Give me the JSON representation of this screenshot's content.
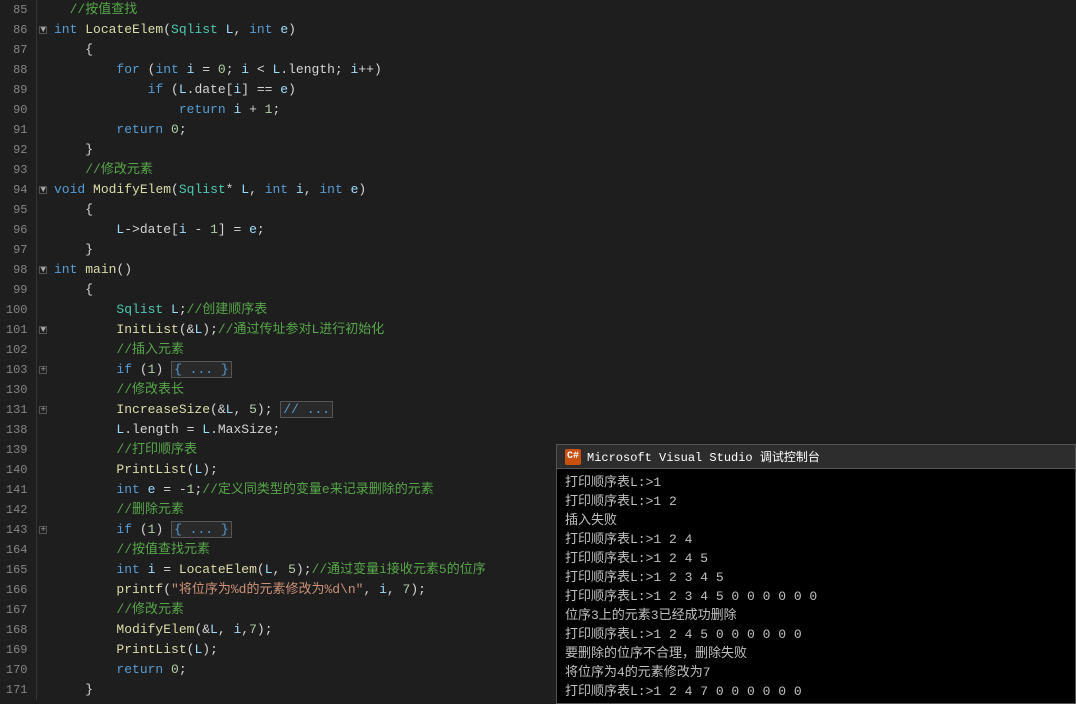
{
  "editor": {
    "lines": [
      {
        "num": 85,
        "fold": "",
        "content": [
          {
            "t": "cmt",
            "v": "  //按值查找"
          }
        ]
      },
      {
        "num": 86,
        "fold": "▼",
        "content": [
          {
            "t": "kw",
            "v": "int"
          },
          {
            "t": "white",
            "v": " "
          },
          {
            "t": "fn",
            "v": "LocateElem"
          },
          {
            "t": "white",
            "v": "("
          },
          {
            "t": "type",
            "v": "Sqlist"
          },
          {
            "t": "white",
            "v": " "
          },
          {
            "t": "param",
            "v": "L"
          },
          {
            "t": "white",
            "v": ", "
          },
          {
            "t": "kw",
            "v": "int"
          },
          {
            "t": "white",
            "v": " "
          },
          {
            "t": "param",
            "v": "e"
          },
          {
            "t": "white",
            "v": ")"
          }
        ]
      },
      {
        "num": 87,
        "fold": "",
        "content": [
          {
            "t": "white",
            "v": "    {"
          }
        ]
      },
      {
        "num": 88,
        "fold": "",
        "content": [
          {
            "t": "white",
            "v": "        "
          },
          {
            "t": "kw",
            "v": "for"
          },
          {
            "t": "white",
            "v": " ("
          },
          {
            "t": "kw",
            "v": "int"
          },
          {
            "t": "white",
            "v": " "
          },
          {
            "t": "param",
            "v": "i"
          },
          {
            "t": "white",
            "v": " = "
          },
          {
            "t": "num",
            "v": "0"
          },
          {
            "t": "white",
            "v": "; "
          },
          {
            "t": "param",
            "v": "i"
          },
          {
            "t": "white",
            "v": " < "
          },
          {
            "t": "param",
            "v": "L"
          },
          {
            "t": "white",
            "v": ".length; "
          },
          {
            "t": "param",
            "v": "i"
          },
          {
            "t": "white",
            "v": "++)"
          }
        ]
      },
      {
        "num": 89,
        "fold": "",
        "content": [
          {
            "t": "white",
            "v": "            "
          },
          {
            "t": "kw",
            "v": "if"
          },
          {
            "t": "white",
            "v": " ("
          },
          {
            "t": "param",
            "v": "L"
          },
          {
            "t": "white",
            "v": ".date["
          },
          {
            "t": "param",
            "v": "i"
          },
          {
            "t": "white",
            "v": "] == "
          },
          {
            "t": "param",
            "v": "e"
          },
          {
            "t": "white",
            "v": ")"
          }
        ]
      },
      {
        "num": 90,
        "fold": "",
        "content": [
          {
            "t": "white",
            "v": "                "
          },
          {
            "t": "kw",
            "v": "return"
          },
          {
            "t": "white",
            "v": " "
          },
          {
            "t": "param",
            "v": "i"
          },
          {
            "t": "white",
            "v": " + "
          },
          {
            "t": "num",
            "v": "1"
          },
          {
            "t": "white",
            "v": ";"
          }
        ]
      },
      {
        "num": 91,
        "fold": "",
        "content": [
          {
            "t": "white",
            "v": "        "
          },
          {
            "t": "kw",
            "v": "return"
          },
          {
            "t": "white",
            "v": " "
          },
          {
            "t": "num",
            "v": "0"
          },
          {
            "t": "white",
            "v": ";"
          }
        ]
      },
      {
        "num": 92,
        "fold": "",
        "content": [
          {
            "t": "white",
            "v": "    }"
          }
        ]
      },
      {
        "num": 93,
        "fold": "",
        "content": [
          {
            "t": "white",
            "v": "    "
          },
          {
            "t": "cmt",
            "v": "//修改元素"
          }
        ]
      },
      {
        "num": 94,
        "fold": "▼",
        "content": [
          {
            "t": "kw",
            "v": "void"
          },
          {
            "t": "white",
            "v": " "
          },
          {
            "t": "fn",
            "v": "ModifyElem"
          },
          {
            "t": "white",
            "v": "("
          },
          {
            "t": "type",
            "v": "Sqlist"
          },
          {
            "t": "white",
            "v": "* "
          },
          {
            "t": "param",
            "v": "L"
          },
          {
            "t": "white",
            "v": ", "
          },
          {
            "t": "kw",
            "v": "int"
          },
          {
            "t": "white",
            "v": " "
          },
          {
            "t": "param",
            "v": "i"
          },
          {
            "t": "white",
            "v": ", "
          },
          {
            "t": "kw",
            "v": "int"
          },
          {
            "t": "white",
            "v": " "
          },
          {
            "t": "param",
            "v": "e"
          },
          {
            "t": "white",
            "v": ")"
          }
        ]
      },
      {
        "num": 95,
        "fold": "",
        "content": [
          {
            "t": "white",
            "v": "    {"
          }
        ]
      },
      {
        "num": 96,
        "fold": "",
        "content": [
          {
            "t": "white",
            "v": "        "
          },
          {
            "t": "param",
            "v": "L"
          },
          {
            "t": "white",
            "v": "->date["
          },
          {
            "t": "param",
            "v": "i"
          },
          {
            "t": "white",
            "v": " - "
          },
          {
            "t": "num",
            "v": "1"
          },
          {
            "t": "white",
            "v": "] = "
          },
          {
            "t": "param",
            "v": "e"
          },
          {
            "t": "white",
            "v": ";"
          }
        ]
      },
      {
        "num": 97,
        "fold": "",
        "content": [
          {
            "t": "white",
            "v": "    }"
          }
        ]
      },
      {
        "num": 98,
        "fold": "▼",
        "content": [
          {
            "t": "kw",
            "v": "int"
          },
          {
            "t": "white",
            "v": " "
          },
          {
            "t": "fn",
            "v": "main"
          },
          {
            "t": "white",
            "v": "()"
          }
        ]
      },
      {
        "num": 99,
        "fold": "",
        "content": [
          {
            "t": "white",
            "v": "    {"
          }
        ]
      },
      {
        "num": 100,
        "fold": "",
        "content": [
          {
            "t": "white",
            "v": "        "
          },
          {
            "t": "type",
            "v": "Sqlist"
          },
          {
            "t": "white",
            "v": " "
          },
          {
            "t": "param",
            "v": "L"
          },
          {
            "t": "white",
            "v": ";"
          },
          {
            "t": "cmt",
            "v": "//创建顺序表"
          }
        ]
      },
      {
        "num": 101,
        "fold": "▼",
        "content": [
          {
            "t": "white",
            "v": "        "
          },
          {
            "t": "fn",
            "v": "InitList"
          },
          {
            "t": "white",
            "v": "(&"
          },
          {
            "t": "param",
            "v": "L"
          },
          {
            "t": "white",
            "v": ");"
          },
          {
            "t": "cmt",
            "v": "//通过传址参对L进行初始化"
          }
        ]
      },
      {
        "num": 102,
        "fold": "",
        "content": [
          {
            "t": "white",
            "v": "        "
          },
          {
            "t": "cmt",
            "v": "//插入元素"
          }
        ]
      },
      {
        "num": 103,
        "fold": "+",
        "content": [
          {
            "t": "white",
            "v": "        "
          },
          {
            "t": "kw",
            "v": "if"
          },
          {
            "t": "white",
            "v": " ("
          },
          {
            "t": "num",
            "v": "1"
          },
          {
            "t": "white",
            "v": ") "
          },
          {
            "t": "expand",
            "v": "{ ... }"
          }
        ]
      },
      {
        "num": 130,
        "fold": "",
        "content": [
          {
            "t": "white",
            "v": "        "
          },
          {
            "t": "cmt",
            "v": "//修改表长"
          }
        ]
      },
      {
        "num": 131,
        "fold": "+",
        "content": [
          {
            "t": "white",
            "v": "        "
          },
          {
            "t": "fn",
            "v": "IncreaseSize"
          },
          {
            "t": "white",
            "v": "(&"
          },
          {
            "t": "param",
            "v": "L"
          },
          {
            "t": "white",
            "v": ", "
          },
          {
            "t": "num",
            "v": "5"
          },
          {
            "t": "white",
            "v": "); "
          },
          {
            "t": "expand",
            "v": "// ..."
          }
        ]
      },
      {
        "num": 138,
        "fold": "",
        "content": [
          {
            "t": "white",
            "v": "        "
          },
          {
            "t": "param",
            "v": "L"
          },
          {
            "t": "white",
            "v": ".length = "
          },
          {
            "t": "param",
            "v": "L"
          },
          {
            "t": "white",
            "v": ".MaxSize;"
          }
        ]
      },
      {
        "num": 139,
        "fold": "",
        "content": [
          {
            "t": "white",
            "v": "        "
          },
          {
            "t": "cmt",
            "v": "//打印顺序表"
          }
        ]
      },
      {
        "num": 140,
        "fold": "",
        "content": [
          {
            "t": "white",
            "v": "        "
          },
          {
            "t": "fn",
            "v": "PrintList"
          },
          {
            "t": "white",
            "v": "("
          },
          {
            "t": "param",
            "v": "L"
          },
          {
            "t": "white",
            "v": ");"
          }
        ]
      },
      {
        "num": 141,
        "fold": "",
        "content": [
          {
            "t": "white",
            "v": "        "
          },
          {
            "t": "kw",
            "v": "int"
          },
          {
            "t": "white",
            "v": " "
          },
          {
            "t": "param",
            "v": "e"
          },
          {
            "t": "white",
            "v": " = -"
          },
          {
            "t": "num",
            "v": "1"
          },
          {
            "t": "white",
            "v": ";"
          },
          {
            "t": "cmt",
            "v": "//定义同类型的变量e来记录删除的元素"
          }
        ]
      },
      {
        "num": 142,
        "fold": "",
        "content": [
          {
            "t": "white",
            "v": "        "
          },
          {
            "t": "cmt",
            "v": "//删除元素"
          }
        ]
      },
      {
        "num": 143,
        "fold": "+",
        "content": [
          {
            "t": "white",
            "v": "        "
          },
          {
            "t": "kw",
            "v": "if"
          },
          {
            "t": "white",
            "v": " ("
          },
          {
            "t": "num",
            "v": "1"
          },
          {
            "t": "white",
            "v": ") "
          },
          {
            "t": "expand",
            "v": "{ ... }"
          }
        ]
      },
      {
        "num": 164,
        "fold": "",
        "content": [
          {
            "t": "white",
            "v": "        "
          },
          {
            "t": "cmt",
            "v": "//按值查找元素"
          }
        ]
      },
      {
        "num": 165,
        "fold": "",
        "content": [
          {
            "t": "white",
            "v": "        "
          },
          {
            "t": "kw",
            "v": "int"
          },
          {
            "t": "white",
            "v": " "
          },
          {
            "t": "param",
            "v": "i"
          },
          {
            "t": "white",
            "v": " = "
          },
          {
            "t": "fn",
            "v": "LocateElem"
          },
          {
            "t": "white",
            "v": "("
          },
          {
            "t": "param",
            "v": "L"
          },
          {
            "t": "white",
            "v": ", "
          },
          {
            "t": "num",
            "v": "5"
          },
          {
            "t": "white",
            "v": ");"
          },
          {
            "t": "cmt",
            "v": "//通过变量i接收元素5的位序"
          }
        ]
      },
      {
        "num": 166,
        "fold": "",
        "content": [
          {
            "t": "white",
            "v": "        "
          },
          {
            "t": "fn",
            "v": "printf"
          },
          {
            "t": "white",
            "v": "("
          },
          {
            "t": "str",
            "v": "\"将位序为%d的元素修改为%d\\n\""
          },
          {
            "t": "white",
            "v": ", "
          },
          {
            "t": "param",
            "v": "i"
          },
          {
            "t": "white",
            "v": ", "
          },
          {
            "t": "num",
            "v": "7"
          },
          {
            "t": "white",
            "v": ");"
          }
        ]
      },
      {
        "num": 167,
        "fold": "",
        "content": [
          {
            "t": "white",
            "v": "        "
          },
          {
            "t": "cmt",
            "v": "//修改元素"
          }
        ]
      },
      {
        "num": 168,
        "fold": "",
        "content": [
          {
            "t": "white",
            "v": "        "
          },
          {
            "t": "fn",
            "v": "ModifyElem"
          },
          {
            "t": "white",
            "v": "(&"
          },
          {
            "t": "param",
            "v": "L"
          },
          {
            "t": "white",
            "v": ", "
          },
          {
            "t": "param",
            "v": "i"
          },
          {
            "t": "white",
            "v": ","
          },
          {
            "t": "num",
            "v": "7"
          },
          {
            "t": "white",
            "v": ");"
          }
        ]
      },
      {
        "num": 169,
        "fold": "",
        "content": [
          {
            "t": "white",
            "v": "        "
          },
          {
            "t": "fn",
            "v": "PrintList"
          },
          {
            "t": "white",
            "v": "("
          },
          {
            "t": "param",
            "v": "L"
          },
          {
            "t": "white",
            "v": ");"
          }
        ]
      },
      {
        "num": 170,
        "fold": "",
        "content": [
          {
            "t": "white",
            "v": "        "
          },
          {
            "t": "kw",
            "v": "return"
          },
          {
            "t": "white",
            "v": " "
          },
          {
            "t": "num",
            "v": "0"
          },
          {
            "t": "white",
            "v": ";"
          }
        ]
      },
      {
        "num": 171,
        "fold": "",
        "content": [
          {
            "t": "white",
            "v": "    }"
          }
        ]
      }
    ]
  },
  "debug_console": {
    "title": "Microsoft Visual Studio 调试控制台",
    "icon_label": "C#",
    "output": [
      "打印顺序表L:>1",
      "打印顺序表L:>1 2",
      "插入失败",
      "打印顺序表L:>1 2 4",
      "打印顺序表L:>1 2 4 5",
      "打印顺序表L:>1 2 3 4 5",
      "打印顺序表L:>1 2 3 4 5 0 0 0 0 0 0",
      "位序3上的元素3已经成功删除",
      "打印顺序表L:>1 2 4 5 0 0 0 0 0 0",
      "要删除的位序不合理，删除失败",
      "将位序为4的元素修改为7",
      "打印顺序表L:>1 2 4 7 0 0 0 0 0 0"
    ]
  }
}
